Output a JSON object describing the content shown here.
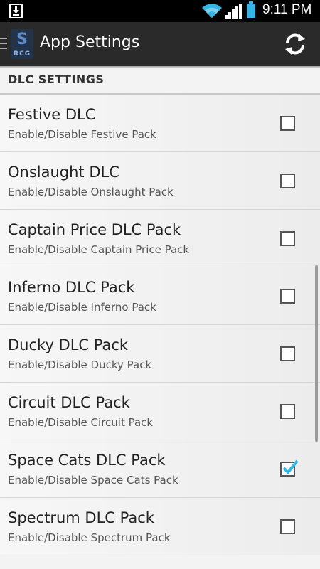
{
  "status_bar": {
    "time": "9:11 PM",
    "download_icon": "download-icon",
    "wifi_icon": "wifi-icon",
    "signal_icon": "signal-icon",
    "battery_icon": "battery-icon",
    "accent_color": "#33b5e5"
  },
  "action_bar": {
    "title": "App Settings",
    "app_icon_text": "RCG",
    "refresh_icon": "refresh-icon",
    "menu_icon": "menu-icon"
  },
  "section": {
    "header": "DLC SETTINGS"
  },
  "preferences": [
    {
      "title": "Festive DLC",
      "summary": "Enable/Disable Festive Pack",
      "checked": false
    },
    {
      "title": "Onslaught DLC",
      "summary": "Enable/Disable Onslaught Pack",
      "checked": false
    },
    {
      "title": "Captain Price DLC Pack",
      "summary": "Enable/Disable Captain Price Pack",
      "checked": false
    },
    {
      "title": "Inferno DLC Pack",
      "summary": "Enable/Disable Inferno Pack",
      "checked": false
    },
    {
      "title": "Ducky DLC Pack",
      "summary": "Enable/Disable Ducky Pack",
      "checked": false
    },
    {
      "title": "Circuit DLC Pack",
      "summary": "Enable/Disable Circuit Pack",
      "checked": false
    },
    {
      "title": "Space Cats DLC Pack",
      "summary": "Enable/Disable Space Cats Pack",
      "checked": true
    },
    {
      "title": "Spectrum DLC Pack",
      "summary": "Enable/Disable Spectrum Pack",
      "checked": false
    }
  ]
}
